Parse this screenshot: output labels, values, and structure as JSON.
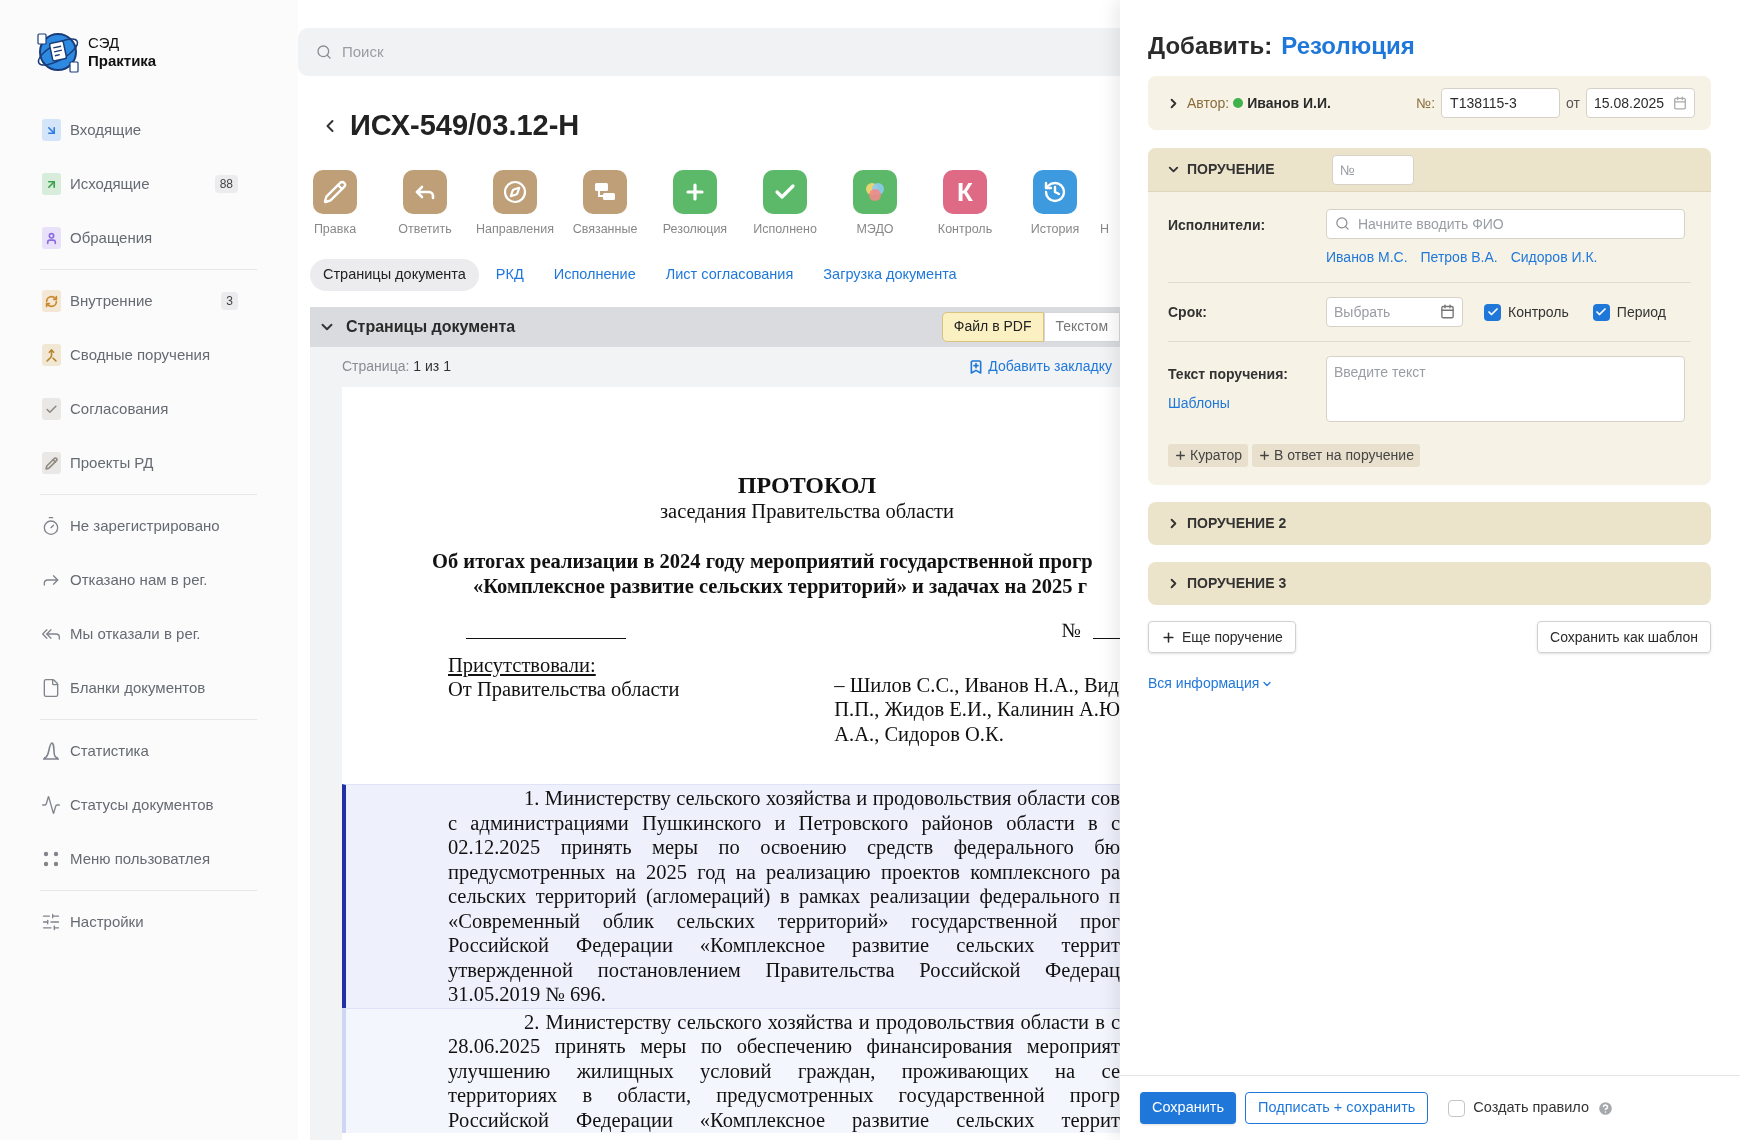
{
  "app": {
    "name_top": "СЭД",
    "name_bottom": "Практика"
  },
  "sidebar": {
    "groups": [
      {
        "items": [
          {
            "label": "Входящие",
            "kind": "tile",
            "color": "#2f7de1"
          },
          {
            "label": "Исходящие",
            "kind": "tile",
            "color": "#3aa04a",
            "badge": "88"
          },
          {
            "label": "Обращения",
            "kind": "tile",
            "color": "#8b6be0"
          }
        ]
      },
      {
        "items": [
          {
            "label": "Внутренние",
            "kind": "tile",
            "color": "#c8892c",
            "badge": "3"
          },
          {
            "label": "Сводные поручения",
            "kind": "tile",
            "color": "#b8862e"
          },
          {
            "label": "Согласования",
            "kind": "tile",
            "color": "#8f8a80"
          },
          {
            "label": "Проекты РД",
            "kind": "tile",
            "color": "#8f8a80"
          }
        ]
      },
      {
        "items": [
          {
            "label": "Не зарегистрировано",
            "kind": "outline"
          },
          {
            "label": "Отказано нам в рег.",
            "kind": "outline"
          },
          {
            "label": "Мы отказали в рег.",
            "kind": "outline"
          },
          {
            "label": "Бланки документов",
            "kind": "outline"
          }
        ]
      },
      {
        "items": [
          {
            "label": "Статистика",
            "kind": "outline"
          },
          {
            "label": "Статусы документов",
            "kind": "outline"
          },
          {
            "label": "Меню пользоватлея",
            "kind": "outline"
          }
        ]
      },
      {
        "items": [
          {
            "label": "Настройки",
            "kind": "outline"
          }
        ]
      }
    ]
  },
  "search": {
    "placeholder": "Поиск"
  },
  "document": {
    "title": "ИСХ-549/03.12-Н"
  },
  "toolbar": [
    {
      "label": "Правка",
      "color": "#bf9f78"
    },
    {
      "label": "Ответить",
      "color": "#bf9f78"
    },
    {
      "label": "Направления",
      "color": "#bf9f78"
    },
    {
      "label": "Связанные",
      "color": "#bf9f78"
    },
    {
      "label": "Резолюция",
      "color": "#5cb96a"
    },
    {
      "label": "Исполнено",
      "color": "#5cb96a"
    },
    {
      "label": "МЭДО",
      "color": "#5cb96a"
    },
    {
      "label": "Контроль",
      "color": "#de6a86",
      "icon_text": "К"
    },
    {
      "label": "История",
      "color": "#3d9ade"
    },
    {
      "label": "Н"
    }
  ],
  "tabs": [
    {
      "label": "Страницы документа",
      "selected": true
    },
    {
      "label": "РКД",
      "selected": false
    },
    {
      "label": "Исполнение",
      "selected": false
    },
    {
      "label": "Лист согласования",
      "selected": false
    },
    {
      "label": "Загрузка документа",
      "selected": false
    }
  ],
  "pages_section": {
    "title": "Страницы документа",
    "expanded": true,
    "view_toggle": [
      {
        "label": "Файл в PDF",
        "selected": true
      },
      {
        "label": "Текстом",
        "selected": false
      }
    ],
    "page_label": "Страница:",
    "page_value": "1 из 1",
    "bookmark": "Добавить закладку"
  },
  "page": {
    "heading": "ПРОТОКОЛ",
    "subheading": "заседания Правительства области",
    "title_lines": [
      "Об итогах реализации в 2024 году мероприятий государственной прогр",
      "«Комплексное развитие сельских территорий» и задачах на 2025 г"
    ],
    "number_sign": "№",
    "present_label": "Присутствовали:",
    "present_from": "От Правительства области",
    "attendees_lines": [
      "– Шилов С.С., Иванов Н.А., Вид",
      "П.П., Жидов Е.И., Калинин А.Ю",
      "А.А., Сидоров О.К."
    ],
    "paragraphs": [
      {
        "selected": true,
        "lines": [
          "1. Министерству сельского хозяйства и продовольствия области сов",
          "с администрациями Пушкинского и Петровского районов области в с",
          "02.12.2025 принять меры по освоению средств федерального бю",
          "предусмотренных на 2025 год на реализацию проектов комплексного ра",
          "сельских территорий (агломераций) в рамках реализации федерального п",
          "«Современный облик сельских территорий» государственной прог",
          "Российской Федерации «Комплексное развитие сельских террит",
          "утвержденной постановлением Правительства Российской Федерац",
          "31.05.2019 № 696."
        ]
      },
      {
        "selected": false,
        "lines": [
          "2. Министерству сельского хозяйства и продовольствия области в с",
          "28.06.2025 принять меры по обеспечению финансирования мероприят",
          "улучшению жилищных условий граждан, проживающих на се",
          "территориях в области, предусмотренных государственной прогр",
          "Российской Федерации «Комплексное развитие сельских террит"
        ]
      }
    ]
  },
  "panel": {
    "title": "Добавить:",
    "title_value": "Резолюция",
    "author": {
      "expanded": false,
      "label": "Автор:",
      "online": true,
      "name": "Иванов И.И.",
      "number_label": "№:",
      "number": "Т138115-3",
      "date_label": "от",
      "date": "15.08.2025"
    },
    "assignments": [
      {
        "title": "ПОРУЧЕНИЕ",
        "expanded": true,
        "number_placeholder": "№",
        "executors_label": "Исполнители:",
        "executors_placeholder": "Начните вводить ФИО",
        "executors": [
          "Иванов М.С.",
          "Петров В.А.",
          "Сидоров И.К."
        ],
        "deadline_label": "Срок:",
        "deadline_placeholder": "Выбрать",
        "options": [
          {
            "label": "Контроль",
            "checked": true
          },
          {
            "label": "Период",
            "checked": true
          }
        ],
        "text_label": "Текст поручения:",
        "text_placeholder": "Введите текст",
        "templates_link": "Шаблоны",
        "chips": [
          "Куратор",
          "В ответ на поручение"
        ]
      },
      {
        "title": "ПОРУЧЕНИЕ 2",
        "expanded": false
      },
      {
        "title": "ПОРУЧЕНИЕ 3",
        "expanded": false
      }
    ],
    "add_assignment": "Еще поручение",
    "save_template": "Сохранить как шаблон",
    "all_info": "Вся информация",
    "footer": {
      "save": "Сохранить",
      "sign_save": "Подписать + сохранить",
      "rule": {
        "label": "Создать правило",
        "checked": false
      }
    }
  }
}
